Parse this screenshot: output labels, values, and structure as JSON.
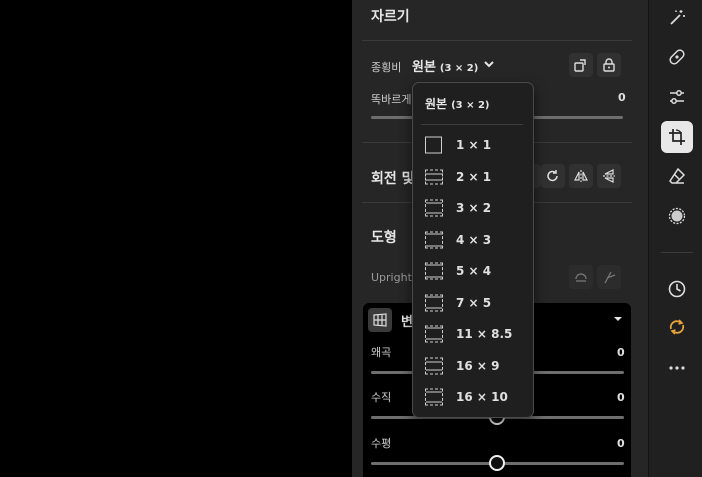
{
  "crop_panel": {
    "title": "자르기",
    "aspect_label": "종횡비",
    "aspect_value": "원본",
    "aspect_ratio": "(3 × 2)",
    "straighten_label": "똑바르게",
    "straighten_value": "0",
    "rotate_label": "회전 및"
  },
  "geometry": {
    "title": "도형",
    "upright_label": "Upright",
    "guided_label": "변",
    "distortion_label": "왜곡",
    "distortion_value": "0",
    "vertical_label": "수직",
    "vertical_value": "0",
    "horizontal_label": "수평",
    "horizontal_value": "0"
  },
  "dropdown": {
    "header": "원본",
    "header_ratio": "(3 × 2)",
    "options": [
      {
        "label": "1 × 1"
      },
      {
        "label": "2 × 1"
      },
      {
        "label": "3 × 2"
      },
      {
        "label": "4 × 3"
      },
      {
        "label": "5 × 4"
      },
      {
        "label": "7 × 5"
      },
      {
        "label": "11 × 8.5"
      },
      {
        "label": "16 × 9"
      },
      {
        "label": "16 × 10"
      }
    ]
  },
  "toolbar": {
    "tools": [
      "magic-wand-icon",
      "healing-icon",
      "adjust-sliders-icon",
      "crop-rotate-icon",
      "eraser-icon",
      "radial-icon",
      "history-icon",
      "presets-icon",
      "more-icon"
    ],
    "active_tool": "crop-rotate-icon",
    "accent_color": "#e8a33a"
  }
}
